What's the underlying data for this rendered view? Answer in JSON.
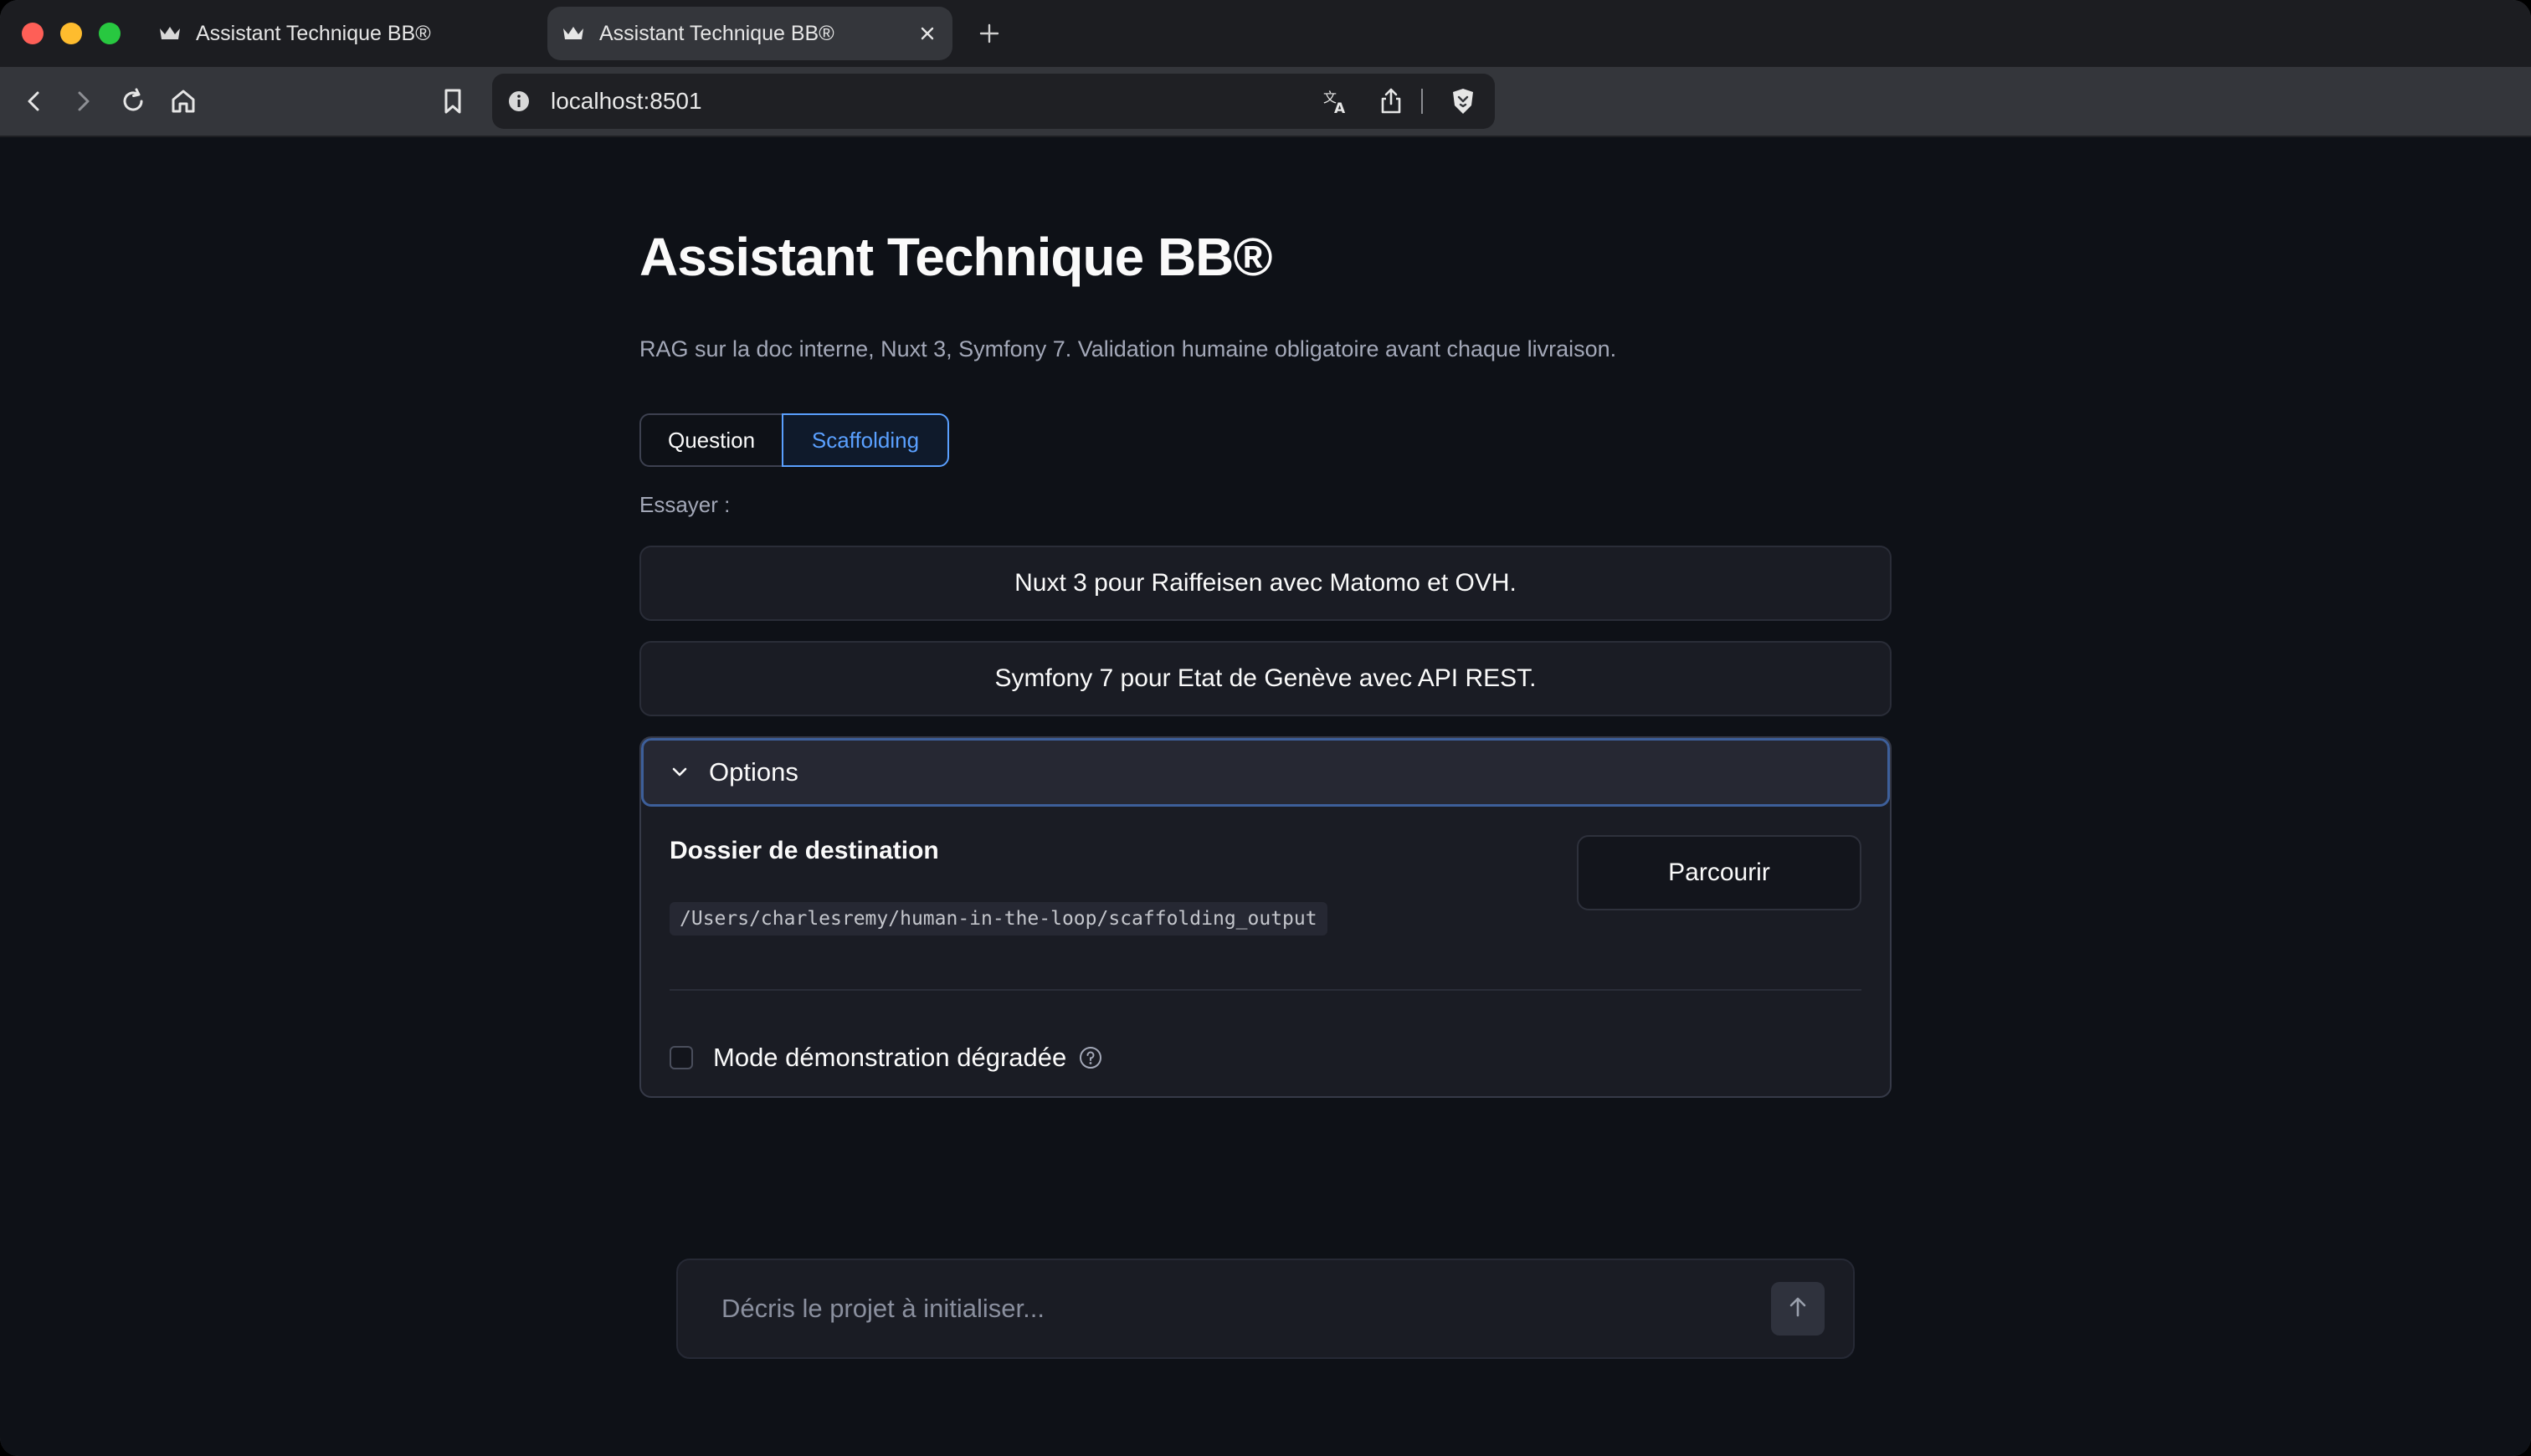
{
  "browser": {
    "tabs": [
      {
        "title": "Assistant Technique BB®",
        "active": false
      },
      {
        "title": "Assistant Technique BB®",
        "active": true
      }
    ],
    "url": "localhost:8501"
  },
  "page": {
    "title": "Assistant Technique BB®",
    "caption": "RAG sur la doc interne, Nuxt 3, Symfony 7. Validation humaine obligatoire avant chaque livraison.",
    "mode_tabs": [
      {
        "label": "Question",
        "selected": false
      },
      {
        "label": "Scaffolding",
        "selected": true
      }
    ],
    "try_label": "Essayer :",
    "suggestions": [
      "Nuxt 3 pour Raiffeisen avec Matomo et OVH.",
      "Symfony 7 pour Etat de Genève avec API REST."
    ],
    "options": {
      "header": "Options",
      "expanded": true,
      "destination_label": "Dossier de destination",
      "destination_path": "/Users/charlesremy/human-in-the-loop/scaffolding_output",
      "browse_label": "Parcourir",
      "demo_mode_label": "Mode démonstration dégradée",
      "demo_mode_checked": false
    },
    "chat": {
      "placeholder": "Décris le projet à initialiser..."
    }
  },
  "colors": {
    "background": "#0e1117",
    "accent": "#5aa0ff",
    "panel": "#1a1c24"
  }
}
